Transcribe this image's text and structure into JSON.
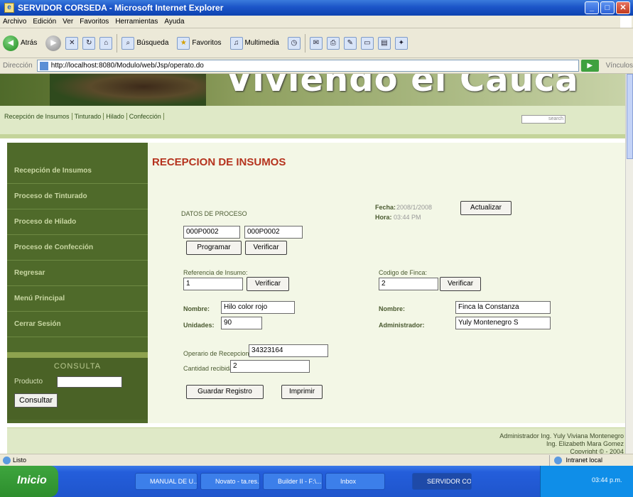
{
  "window": {
    "title": "SERVIDOR CORSEDA - Microsoft Internet Explorer"
  },
  "menu": [
    "Archivo",
    "Edición",
    "Ver",
    "Favoritos",
    "Herramientas",
    "Ayuda"
  ],
  "toolbar": {
    "back": "Atrás",
    "search": "Búsqueda",
    "favorites": "Favoritos",
    "multimedia": "Multimedia"
  },
  "address": {
    "label": "Dirección",
    "url": "http://localhost:8080/Modulo/web/Jsp/operato.do",
    "links": "Vínculos"
  },
  "site": {
    "banner_title": "Viviendo el Cauca",
    "nav": [
      "Recepción de Insumos",
      "Tinturado",
      "Hilado",
      "Confección"
    ],
    "search_placeholder": "search"
  },
  "sidebar": {
    "items": [
      "Recepción de Insumos",
      "Proceso de Tinturado",
      "Proceso de Hilado",
      "Proceso de Confección",
      "Regresar",
      "Menú Principal",
      "Cerrar Sesión"
    ],
    "consulta_title": "CONSULTA",
    "producto_label": "Producto",
    "consultar_button": "Consultar"
  },
  "form": {
    "heading": "RECEPCION DE INSUMOS",
    "datos_label": "DATOS DE PROCESO",
    "fecha_label": "Fecha:",
    "fecha_value": "2008/1/2008",
    "hora_label": "Hora:",
    "hora_value": "03:44 PM",
    "actualizar_button": "Actualizar",
    "proceso_code1": "000P0002",
    "proceso_code2": "000P0002",
    "programar_button": "Programar",
    "verificar_button": "Verificar",
    "referencia_label": "Referencia de Insumo:",
    "referencia_value": "1",
    "codigo_finca_label": "Codigo de Finca:",
    "codigo_finca_value": "2",
    "nombre_label": "Nombre:",
    "nombre_value": "Hilo color rojo",
    "unidades_label": "Unidades:",
    "unidades_value": "90",
    "finca_nombre_label": "Nombre:",
    "finca_nombre_value": "Finca la Constanza",
    "administrador_label": "Administrador:",
    "administrador_value": "Yuly  Montenegro S",
    "operario_label": "Operario de Recepcion:",
    "operario_value": "34323164",
    "cantidad_label": "Cantidad recibida:",
    "cantidad_value": "2",
    "guardar_button": "Guardar Registro",
    "imprimir_button": "Imprimir"
  },
  "footer": {
    "line1": "Administrador Ing. Yuly Viviana Montenegro",
    "line2": "Ing. Elizabeth Mara Gomez",
    "line3": "Copyright © - 2004"
  },
  "status": {
    "left": "Listo",
    "zone": "Intranet local"
  },
  "taskbar": {
    "start": "Inicio",
    "tasks": [
      "MANUAL DE U...",
      "Novato - ta.res...",
      "Builder II - F:\\...",
      "Inbox",
      "SERVIDOR CO..."
    ],
    "clock": "03:44 p.m."
  },
  "colors": {
    "sidebar": "#4f6a2a",
    "main_bg": "#f3f7e6",
    "heading": "#b5331e"
  }
}
